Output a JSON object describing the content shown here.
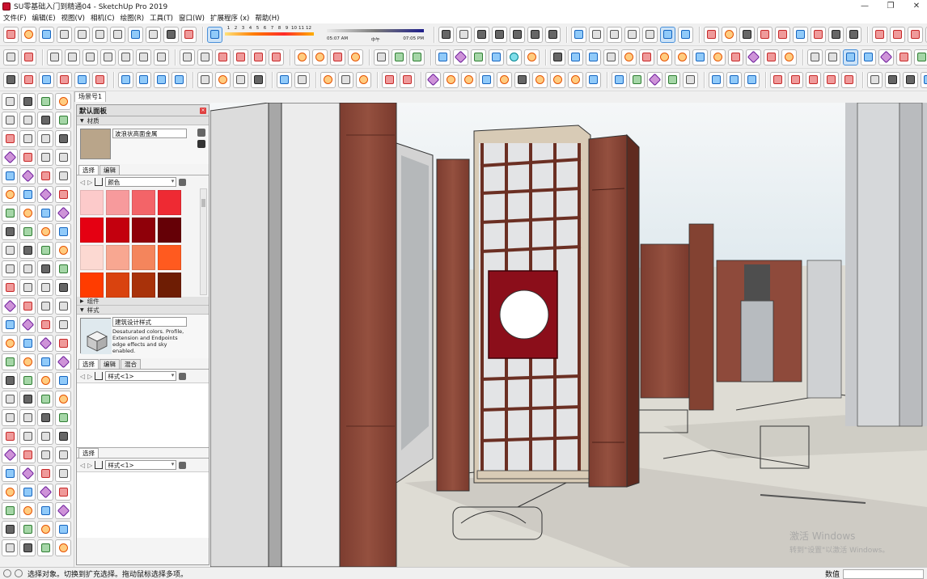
{
  "window": {
    "title": "SU零基础入门到精通04 - SketchUp Pro 2019"
  },
  "menu": [
    "文件(F)",
    "编辑(E)",
    "视图(V)",
    "相机(C)",
    "绘图(R)",
    "工具(T)",
    "窗口(W)",
    "扩展程序 (x)",
    "帮助(H)"
  ],
  "shadow": {
    "months": [
      "1",
      "2",
      "3",
      "4",
      "5",
      "6",
      "7",
      "8",
      "9",
      "10",
      "11",
      "12"
    ],
    "time_start": "05:07 AM",
    "time_mid": "中午",
    "time_end": "07:05 PM"
  },
  "scene_tabs": [
    "场景号1"
  ],
  "tray": {
    "title": "默认面板",
    "materials": {
      "section": "材质",
      "name": "波浪状高面金属",
      "tabs": [
        "选择",
        "编辑"
      ],
      "collection": "颜色",
      "swatches": [
        "#fccaca",
        "#f79a9c",
        "#f36468",
        "#ee2a33",
        "#e50012",
        "#c3000e",
        "#8f0009",
        "#650006",
        "#fcd9d2",
        "#f8a791",
        "#f4855c",
        "#ff5a1f",
        "#ff3c00",
        "#d9430f",
        "#a8320a",
        "#6e1d04"
      ]
    },
    "components": {
      "section": "组件"
    },
    "styles": {
      "section": "样式",
      "name": "建筑设计样式",
      "description": "Desaturated colors. Profile, Extension and Endpoints edge effects and sky enabled.",
      "tabs": [
        "选择",
        "编辑",
        "混合"
      ],
      "collection": "样式<1>"
    },
    "select2": {
      "label": "选择",
      "collection": "样式<1>"
    }
  },
  "status": {
    "hint": "选择对象。切换到扩充选择。拖动鼠标选择多项。",
    "vcb_label": "数值"
  },
  "watermark": {
    "line1": "激活 Windows",
    "line2": "转到\"设置\"以激活 Windows。"
  },
  "colors": {
    "wood": "#8f4a3c",
    "wood_dark": "#6e3529",
    "red_panel": "#8b0e1a",
    "sky": "#dfe9ee",
    "floor": "#dedcd4"
  }
}
